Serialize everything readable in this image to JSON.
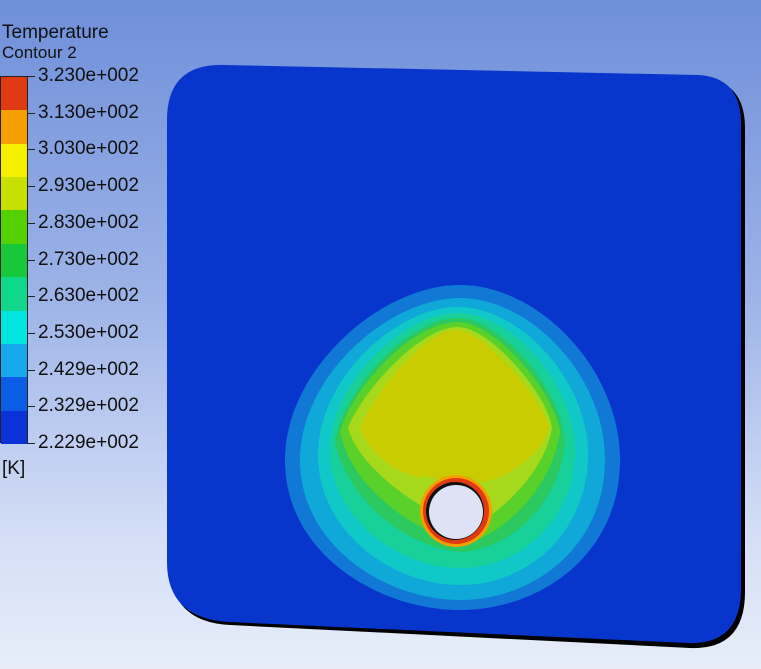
{
  "legend": {
    "title": "Temperature",
    "subtitle": "Contour 2",
    "unit": "[K]",
    "ticks": [
      "3.230e+002",
      "3.130e+002",
      "3.030e+002",
      "2.930e+002",
      "2.830e+002",
      "2.730e+002",
      "2.630e+002",
      "2.530e+002",
      "2.429e+002",
      "2.329e+002",
      "2.229e+002"
    ],
    "band_colors": [
      "#e03a12",
      "#f5a000",
      "#f5f000",
      "#c8e000",
      "#55d000",
      "#18c83a",
      "#10d78a",
      "#00e5e0",
      "#18a8ee",
      "#0c5de6",
      "#0a32d8"
    ]
  },
  "contour": {
    "background_color": "#0836cc",
    "level_colors": [
      "#0836cc",
      "#1278d6",
      "#10a8d8",
      "#10c8c8",
      "#18d09a",
      "#2cc860",
      "#5ad02a",
      "#a6d81c",
      "#c8cc00"
    ],
    "ring_colors": [
      "#f5a000",
      "#e03a12"
    ],
    "hole_color": "#dde3f4"
  }
}
